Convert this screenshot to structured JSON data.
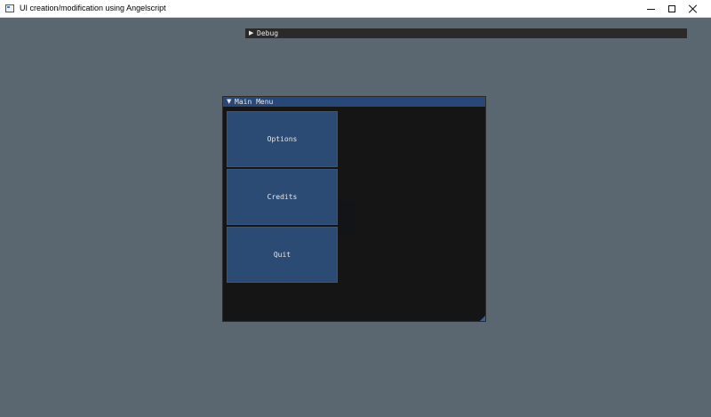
{
  "window": {
    "title": "UI creation/modification using Angelscript",
    "icon": "app-window-icon"
  },
  "debug_window": {
    "title": "Debug",
    "collapse_icon": "triangle-right-icon",
    "collapse_glyph": "▶"
  },
  "main_menu": {
    "title": "Main Menu",
    "collapse_icon": "triangle-down-icon",
    "collapse_glyph": "▼",
    "buttons": [
      {
        "label": "Options"
      },
      {
        "label": "Credits"
      },
      {
        "label": "Quit"
      }
    ]
  },
  "colors": {
    "background": "#5b6770",
    "window_bg": "#151515",
    "titlebar_active": "#28487a",
    "button": "#2b4a74",
    "text": "#e8e8e8"
  }
}
